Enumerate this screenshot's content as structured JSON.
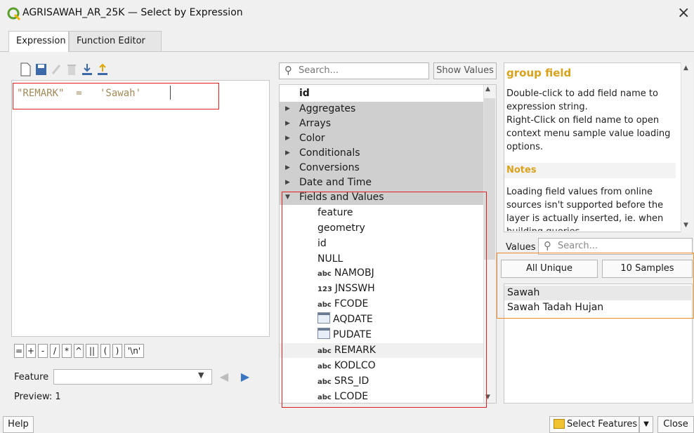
{
  "window": {
    "title": "AGRISAWAH_AR_25K — Select by Expression",
    "close_glyph": "×"
  },
  "tabs": [
    {
      "label": "Expression"
    },
    {
      "label": "Function Editor"
    }
  ],
  "editor": {
    "text": "\"REMARK\"  =   'Sawah'"
  },
  "operators": [
    "=",
    "+",
    "-",
    "/",
    "*",
    "^",
    "||",
    "(",
    ")",
    "'\\n'"
  ],
  "feature": {
    "label": "Feature",
    "value": ""
  },
  "preview": {
    "label": "Preview: 1"
  },
  "search": {
    "placeholder": "Search...",
    "show_values": "Show Values"
  },
  "tree": {
    "header": "id",
    "groups": [
      "Aggregates",
      "Arrays",
      "Color",
      "Conditionals",
      "Conversions",
      "Date and Time",
      "Fields and Values"
    ],
    "items": [
      {
        "type": "",
        "label": "feature"
      },
      {
        "type": "",
        "label": "geometry"
      },
      {
        "type": "",
        "label": "id"
      },
      {
        "type": "",
        "label": "NULL"
      },
      {
        "type": "abc",
        "label": "NAMOBJ"
      },
      {
        "type": "123",
        "label": "JNSSWH"
      },
      {
        "type": "abc",
        "label": "FCODE"
      },
      {
        "type": "date",
        "label": "AQDATE"
      },
      {
        "type": "date",
        "label": "PUDATE"
      },
      {
        "type": "abc",
        "label": "REMARK"
      },
      {
        "type": "abc",
        "label": "KODLCO"
      },
      {
        "type": "abc",
        "label": "SRS_ID"
      },
      {
        "type": "abc",
        "label": "LCODE"
      }
    ]
  },
  "help": {
    "title": "group field",
    "body": "Double-click to add field name to expression string.\nRight-Click on field name to open context menu sample value loading options.",
    "notes_heading": "Notes",
    "notes_body": "Loading field values from online sources isn't supported before the layer is actually inserted, ie. when building queries"
  },
  "values": {
    "label": "Values",
    "search_placeholder": "Search...",
    "all_unique": "All Unique",
    "samples": "10 Samples",
    "items": [
      "Sawah",
      "Sawah Tadah Hujan"
    ]
  },
  "footer": {
    "help": "Help",
    "select_features": "Select Features",
    "close": "Close"
  },
  "colors": {
    "highlight_red": "#e02020",
    "highlight_orange": "#f08a28",
    "help_title": "#d9a21c"
  }
}
